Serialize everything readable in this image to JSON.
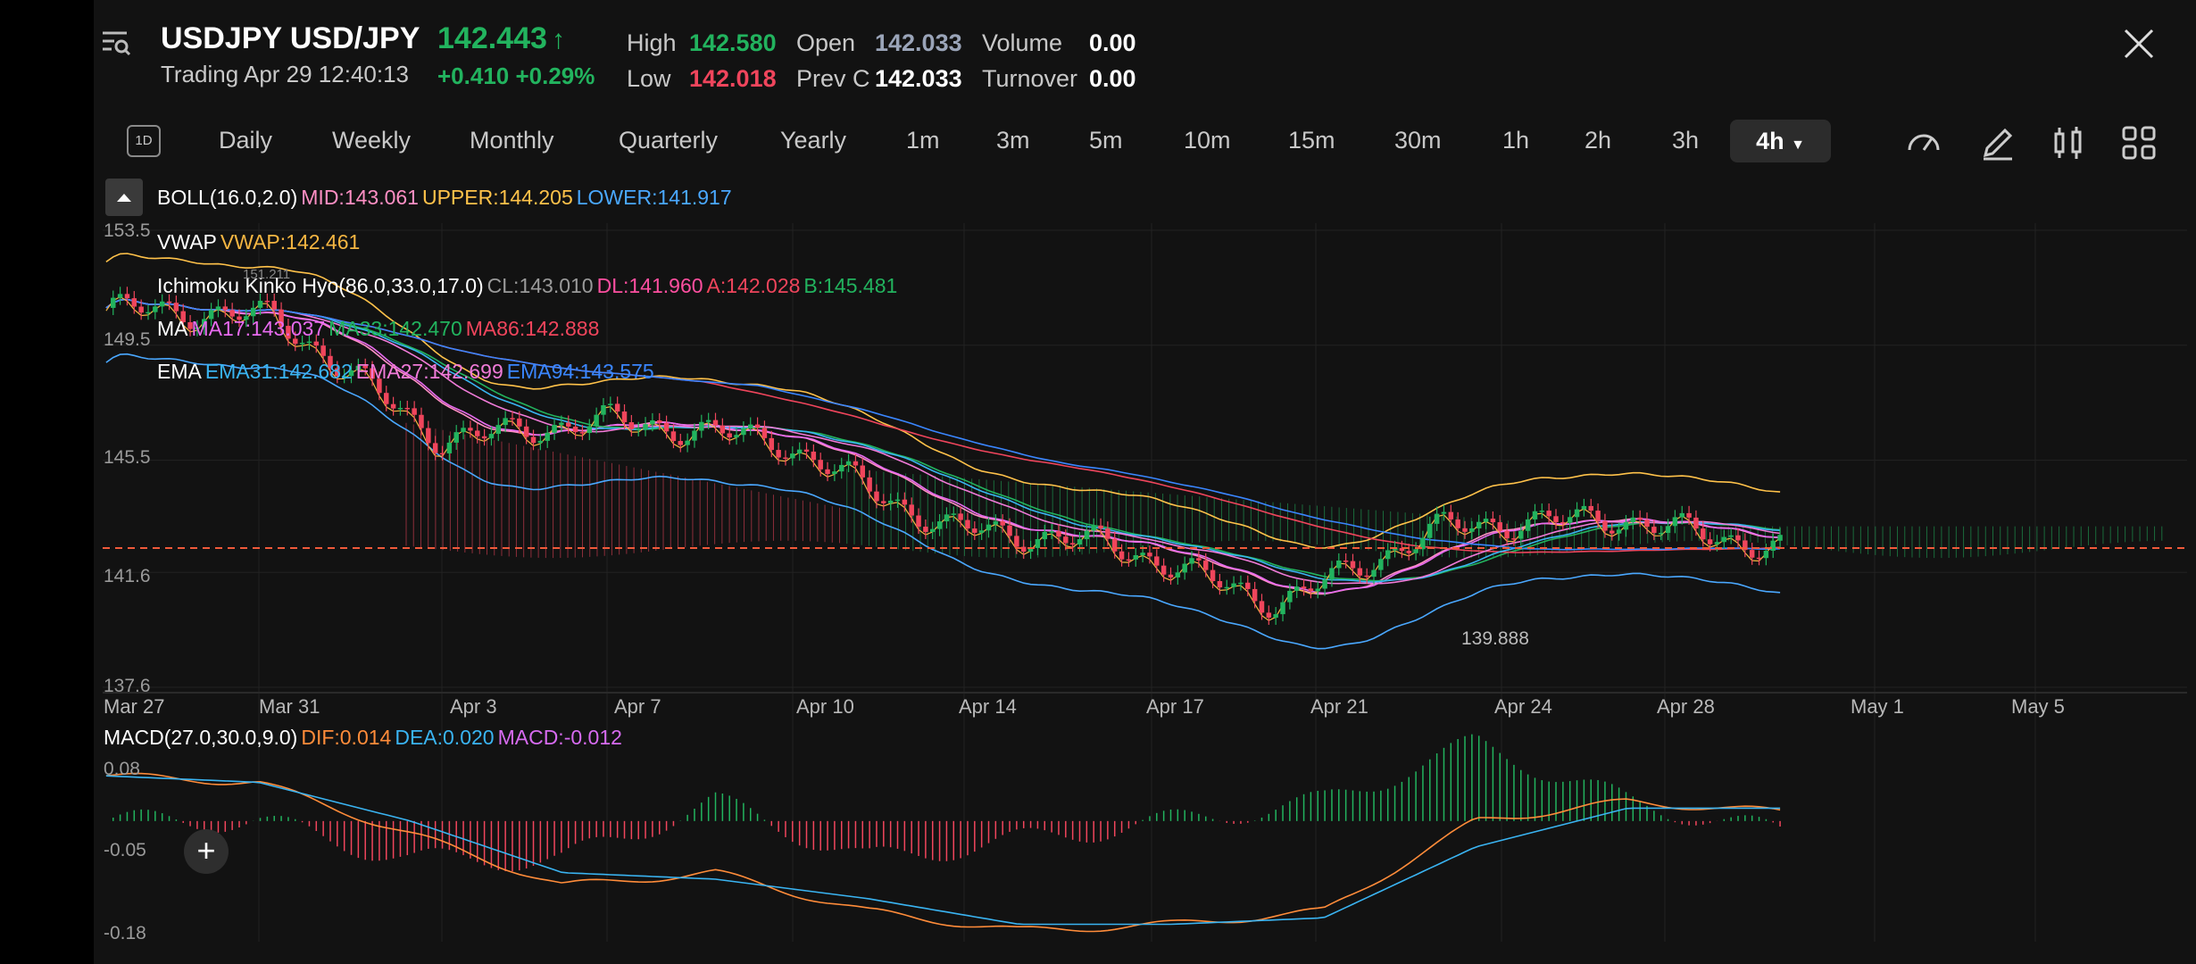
{
  "header": {
    "symbol": "USDJPY USD/JPY",
    "price": "142.443",
    "trading_status": "Trading  Apr 29 12:40:13",
    "change": "+0.410 +0.29%",
    "stats": [
      {
        "label": "High",
        "value": "142.580",
        "color": "#22b35e"
      },
      {
        "label": "Low",
        "value": "142.018",
        "color": "#f0455c"
      },
      {
        "label": "Open",
        "value": "142.033",
        "color": "#9aa4b8"
      },
      {
        "label": "Prev C",
        "value": "142.033",
        "color": "#ffffff"
      },
      {
        "label": "Volume",
        "value": "0.00",
        "color": "#ffffff"
      },
      {
        "label": "Turnover",
        "value": "0.00",
        "color": "#ffffff"
      }
    ]
  },
  "timeframes": {
    "badge": "1D",
    "items": [
      "Daily",
      "Weekly",
      "Monthly",
      "Quarterly",
      "Yearly",
      "1m",
      "3m",
      "5m",
      "10m",
      "15m",
      "30m",
      "1h",
      "2h",
      "3h"
    ],
    "active": "4h"
  },
  "tools": [
    "speedometer-icon",
    "pencil-icon",
    "candle-settings-icon",
    "grid-icon"
  ],
  "indicators": {
    "boll": {
      "name": "BOLL(16.0,2.0)",
      "mid": "MID:143.061",
      "upper": "UPPER:144.205",
      "lower": "LOWER:141.917"
    },
    "vwap": {
      "name": "VWAP",
      "value": "VWAP:142.461"
    },
    "ichimoku": {
      "name": "Ichimoku Kinko Hyo(86.0,33.0,17.0)",
      "cl": "CL:143.010",
      "dl": "DL:141.960",
      "a": "A:142.028",
      "b": "B:145.481"
    },
    "ma": {
      "name": "MA",
      "ma17": "MA17:143.037",
      "ma33": "MA33:142.470",
      "ma86": "MA86:142.888"
    },
    "ema": {
      "name": "EMA",
      "ema31": "EMA31:142.682",
      "ema27": "EMA27:142.699",
      "ema94": "EMA94:143.575"
    },
    "macd": {
      "name": "MACD(27.0,30.0,9.0)",
      "dif": "DIF:0.014",
      "dea": "DEA:0.020",
      "macd": "MACD:-0.012"
    }
  },
  "axes": {
    "price_ticks": [
      "153.5",
      "149.5",
      "145.5",
      "141.6",
      "137.6"
    ],
    "macd_ticks": [
      "0.08",
      "-0.05",
      "-0.18"
    ],
    "dates": [
      "Mar 27",
      "Mar 31",
      "Apr 3",
      "Apr 7",
      "Apr 10",
      "Apr 14",
      "Apr 17",
      "Apr 21",
      "Apr 24",
      "Apr 28",
      "May 1",
      "May 5"
    ],
    "low_marker": "139.888",
    "high_marker": "151.211"
  },
  "colors": {
    "up": "#22b35e",
    "down": "#f0455c",
    "boll_mid": "#ff8fc4",
    "boll_upper": "#ffc24a",
    "boll_lower": "#4aa8ff",
    "vwap": "#f5b642",
    "ichimoku_cl": "#9a9a9a",
    "ichimoku_dl": "#ff4fa0",
    "ichimoku_a": "#f0455c",
    "ichimoku_b": "#22b35e",
    "ma17": "#e86bf0",
    "ma33": "#22b35e",
    "ma86": "#f0455c",
    "ema31": "#3ab4f2",
    "ema27": "#f07bd8",
    "ema94": "#3a86ff",
    "dif": "#ff8c3a",
    "dea": "#3ab4f2",
    "macd": "#d76bf0"
  },
  "chart_data": {
    "type": "line",
    "title": "",
    "price_range": [
      137.6,
      153.5
    ],
    "macd_range": [
      -0.18,
      0.08
    ],
    "close_series": [
      {
        "date": "Mar 27",
        "value": 150.8
      },
      {
        "date": "Mar 31",
        "value": 150.5
      },
      {
        "date": "Apr 3",
        "value": 146.2
      },
      {
        "date": "Apr 7",
        "value": 146.9
      },
      {
        "date": "Apr 10",
        "value": 146.2
      },
      {
        "date": "Apr 14",
        "value": 143.2
      },
      {
        "date": "Apr 17",
        "value": 142.6
      },
      {
        "date": "Apr 21",
        "value": 140.5
      },
      {
        "date": "Apr 24",
        "value": 143.2
      },
      {
        "date": "Apr 28",
        "value": 143.5
      },
      {
        "date": "Apr 29",
        "value": 142.443
      }
    ],
    "reference_line": 142.443,
    "macd_dif": [
      0.07,
      0.06,
      -0.02,
      -0.1,
      -0.08,
      -0.14,
      -0.17,
      -0.16,
      -0.14,
      0.0,
      0.03,
      0.014
    ],
    "macd_dea": [
      0.07,
      0.06,
      0.0,
      -0.08,
      -0.09,
      -0.12,
      -0.16,
      -0.16,
      -0.15,
      -0.04,
      0.02,
      0.02
    ]
  }
}
